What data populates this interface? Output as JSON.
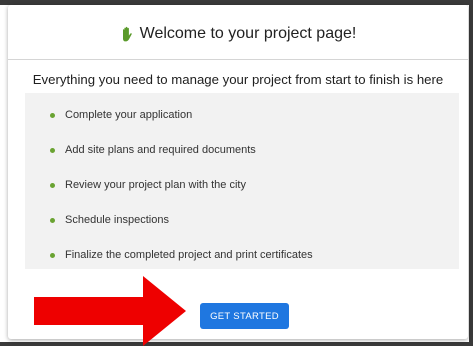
{
  "modal": {
    "title": "Welcome to your project page!",
    "subtitle": "Everything you need to manage your project from start to finish is here",
    "tasks": [
      {
        "label": "Complete your application"
      },
      {
        "label": "Add site plans and required documents"
      },
      {
        "label": "Review your project plan with the city"
      },
      {
        "label": "Schedule inspections"
      },
      {
        "label": "Finalize the completed project and print certificates"
      }
    ],
    "button_label": "GET STARTED"
  },
  "icons": {
    "header": "waving-hand-icon",
    "bullet": "bullet-dot-icon",
    "annotation": "red-arrow-icon"
  },
  "colors": {
    "accent_button": "#1f77e0",
    "bullet": "#6aa332",
    "wave_icon": "#5a9a2a",
    "panel_background": "#f2f2f2",
    "annotation_arrow": "#ee0000"
  }
}
